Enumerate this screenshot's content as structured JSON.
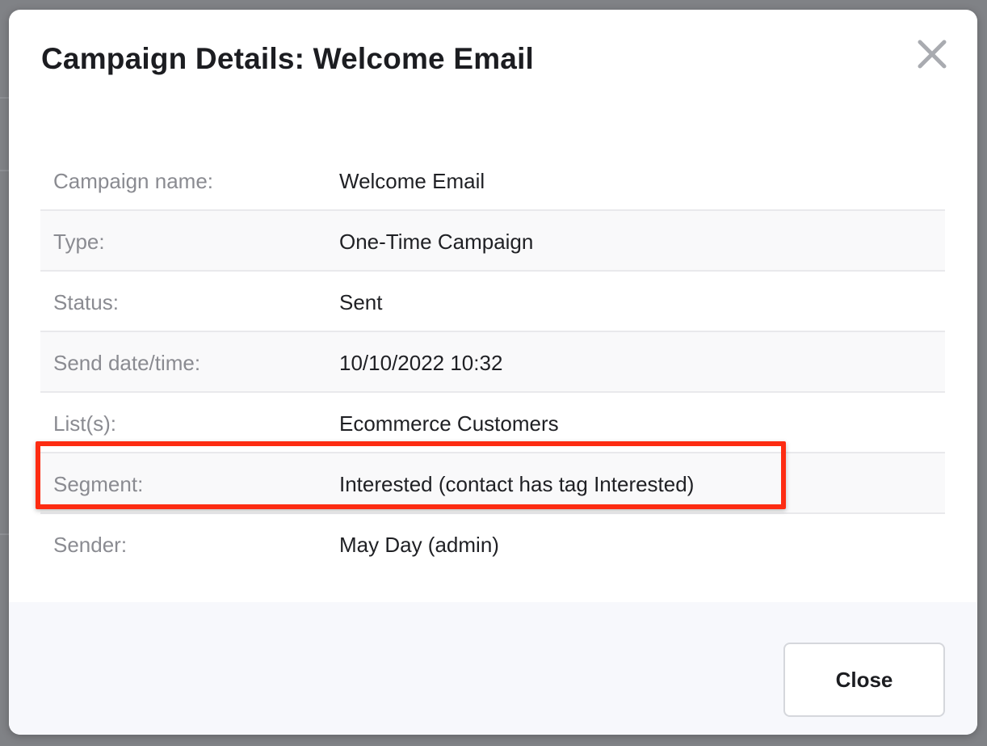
{
  "modal": {
    "title": "Campaign Details: Welcome Email",
    "close_icon": "close-x-icon"
  },
  "details": [
    {
      "label": "Campaign name:",
      "value": "Welcome Email"
    },
    {
      "label": "Type:",
      "value": "One-Time Campaign"
    },
    {
      "label": "Status:",
      "value": "Sent"
    },
    {
      "label": "Send date/time:",
      "value": "10/10/2022 10:32"
    },
    {
      "label": "List(s):",
      "value": "Ecommerce Customers"
    },
    {
      "label": "Segment:",
      "value": "Interested (contact has tag Interested)"
    },
    {
      "label": "Sender:",
      "value": "May Day (admin)"
    }
  ],
  "footer": {
    "close_label": "Close"
  },
  "colors": {
    "highlight": "#fd2c12",
    "footer_bg": "#f7f8fc",
    "row_shade": "#f9f9fa"
  }
}
